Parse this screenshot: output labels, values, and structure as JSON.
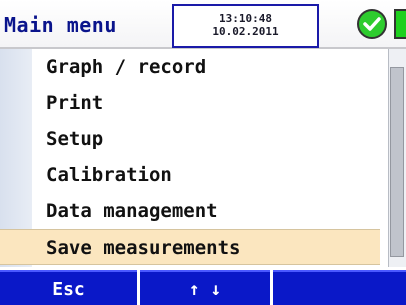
{
  "header": {
    "title": "Main menu",
    "time": "13:10:48",
    "date": "10.02.2011",
    "status_icon": "check-circle-icon",
    "battery_icon": "battery-icon"
  },
  "menu": {
    "items": [
      {
        "label": "Graph / record"
      },
      {
        "label": "Print"
      },
      {
        "label": "Setup"
      },
      {
        "label": "Calibration"
      },
      {
        "label": "Data management"
      },
      {
        "label": "Save measurements",
        "selected": true
      }
    ]
  },
  "softkeys": {
    "key1": "Esc",
    "key2": "↑ ↓",
    "key3": ""
  },
  "colors": {
    "title": "#0a148c",
    "softkey_bg": "#0a18c8",
    "selected_bg": "#fbe6bf",
    "status_ok": "#2ecc2e"
  }
}
